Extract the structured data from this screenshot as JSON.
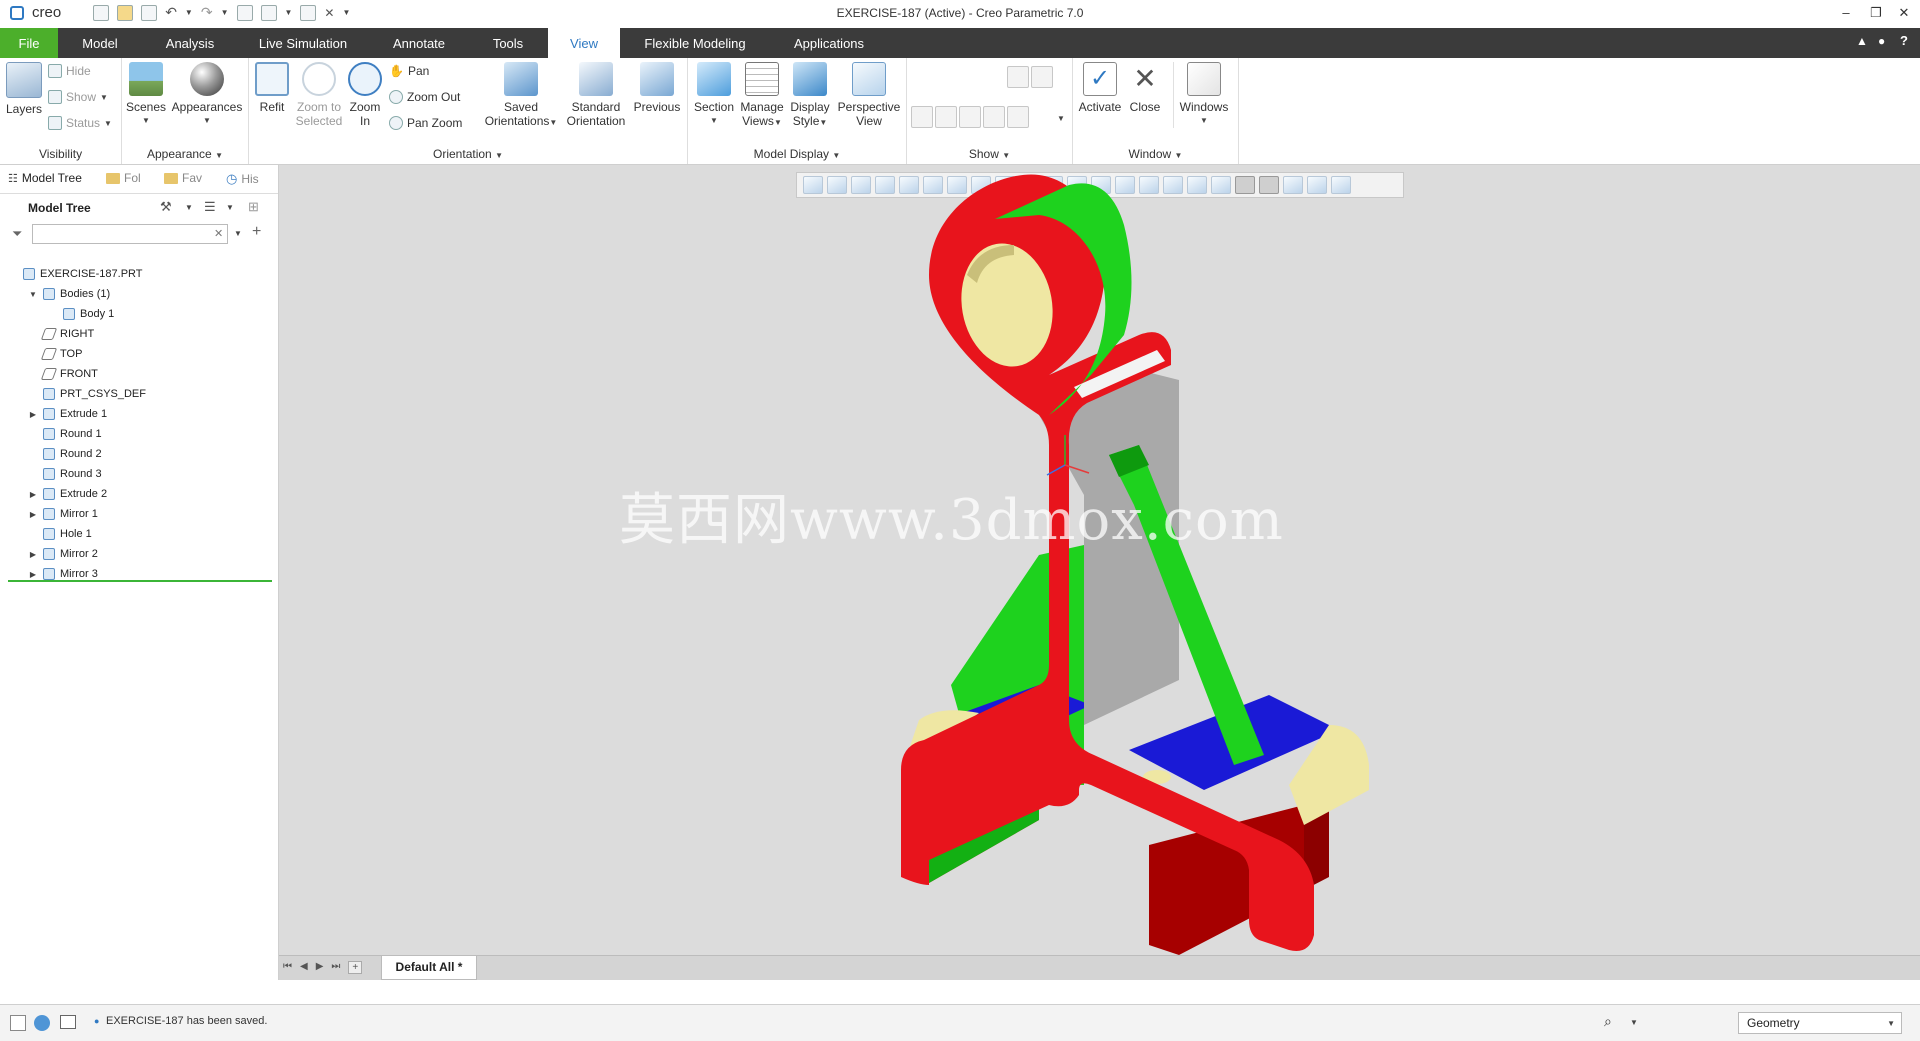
{
  "app": {
    "logo": "creo",
    "title": "EXERCISE-187 (Active) - Creo Parametric 7.0"
  },
  "menu_tabs": [
    "File",
    "Model",
    "Analysis",
    "Live Simulation",
    "Annotate",
    "Tools",
    "View",
    "Flexible Modeling",
    "Applications"
  ],
  "active_tab": "View",
  "ribbon": {
    "visibility": {
      "label": "Visibility",
      "layers": "Layers",
      "hide": "Hide",
      "show": "Show",
      "status": "Status"
    },
    "appearance": {
      "label": "Appearance",
      "scenes": "Scenes",
      "appearances": "Appearances"
    },
    "orientation": {
      "label": "Orientation",
      "refit": "Refit",
      "zoom_to_selected": [
        "Zoom to",
        "Selected"
      ],
      "zoom_in": [
        "Zoom",
        "In"
      ],
      "pan": "Pan",
      "zoom_out": "Zoom Out",
      "pan_zoom": "Pan Zoom",
      "saved_orientations": [
        "Saved",
        "Orientations"
      ],
      "standard_orientation": [
        "Standard",
        "Orientation"
      ],
      "previous": "Previous"
    },
    "model_display": {
      "label": "Model Display",
      "section": "Section",
      "manage_views": [
        "Manage",
        "Views"
      ],
      "display_style": [
        "Display",
        "Style"
      ],
      "perspective_view": [
        "Perspective",
        "View"
      ]
    },
    "show": {
      "label": "Show"
    },
    "window": {
      "label": "Window",
      "activate": "Activate",
      "close": "Close",
      "windows": "Windows"
    }
  },
  "panel_tabs": [
    "Model Tree",
    "Fol",
    "Fav",
    "His"
  ],
  "model_tree": {
    "header": "Model Tree",
    "search_placeholder": "",
    "items": [
      {
        "label": "EXERCISE-187.PRT",
        "indent": 0,
        "expander": ""
      },
      {
        "label": "Bodies (1)",
        "indent": 1,
        "expander": "down"
      },
      {
        "label": "Body 1",
        "indent": 2,
        "expander": ""
      },
      {
        "label": "RIGHT",
        "indent": 1,
        "expander": ""
      },
      {
        "label": "TOP",
        "indent": 1,
        "expander": ""
      },
      {
        "label": "FRONT",
        "indent": 1,
        "expander": ""
      },
      {
        "label": "PRT_CSYS_DEF",
        "indent": 1,
        "expander": ""
      },
      {
        "label": "Extrude 1",
        "indent": 1,
        "expander": "right"
      },
      {
        "label": "Round 1",
        "indent": 1,
        "expander": ""
      },
      {
        "label": "Round 2",
        "indent": 1,
        "expander": ""
      },
      {
        "label": "Round 3",
        "indent": 1,
        "expander": ""
      },
      {
        "label": "Extrude 2",
        "indent": 1,
        "expander": "right"
      },
      {
        "label": "Mirror 1",
        "indent": 1,
        "expander": "right"
      },
      {
        "label": "Hole 1",
        "indent": 1,
        "expander": ""
      },
      {
        "label": "Mirror 2",
        "indent": 1,
        "expander": "right"
      },
      {
        "label": "Mirror 3",
        "indent": 1,
        "expander": "right"
      }
    ]
  },
  "graphics": {
    "watermark": "莫西网www.3dmox.com",
    "bottom_tab": "Default All *"
  },
  "status": {
    "message": "EXERCISE-187 has been saved.",
    "filter": "Geometry"
  },
  "colors": {
    "file_tab": "#4caf2b",
    "tab_bar": "#3b3b3b",
    "active_tab_text": "#2f79c2",
    "model_red": "#e8141c",
    "model_green": "#1ed21e",
    "model_blue": "#1a1ad6",
    "model_cream": "#efe7a3",
    "model_gray": "#a9a9a9",
    "background": "#dcdcdc"
  }
}
